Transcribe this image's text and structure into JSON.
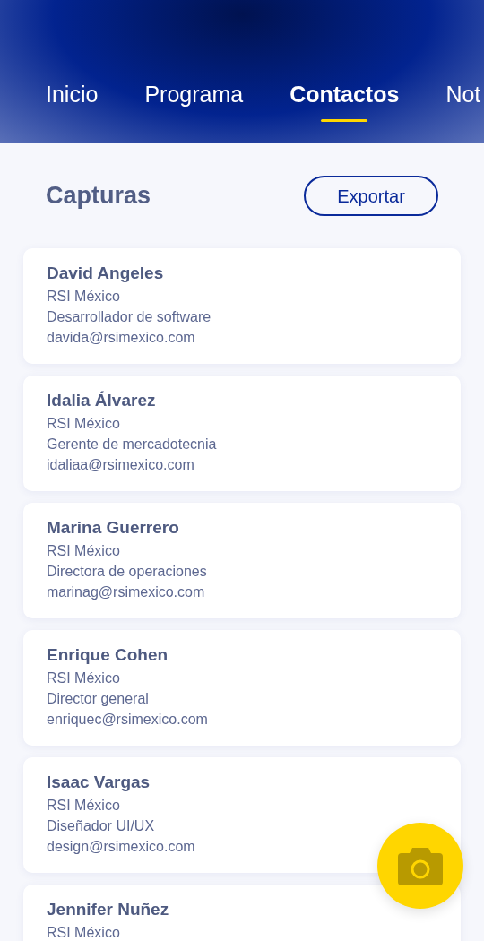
{
  "tabs": [
    {
      "label": "Inicio",
      "selected": false
    },
    {
      "label": "Programa",
      "selected": false
    },
    {
      "label": "Contactos",
      "selected": true
    },
    {
      "label": "Not",
      "selected": false
    }
  ],
  "section": {
    "title": "Capturas",
    "export_button": "Exportar"
  },
  "contacts": [
    {
      "name": "David Angeles",
      "company": "RSI México",
      "role": "Desarrollador de software",
      "email": "davida@rsimexico.com"
    },
    {
      "name": "Idalia Álvarez",
      "company": "RSI México",
      "role": "Gerente de mercadotecnia",
      "email": "idaliaa@rsimexico.com"
    },
    {
      "name": "Marina Guerrero",
      "company": "RSI México",
      "role": "Directora de operaciones",
      "email": "marinag@rsimexico.com"
    },
    {
      "name": "Enrique Cohen",
      "company": "RSI México",
      "role": "Director general",
      "email": "enriquec@rsimexico.com"
    },
    {
      "name": "Isaac Vargas",
      "company": "RSI México",
      "role": "Diseñador UI/UX",
      "email": "design@rsimexico.com"
    },
    {
      "name": "Jennifer Nuñez",
      "company": "RSI México"
    }
  ]
}
